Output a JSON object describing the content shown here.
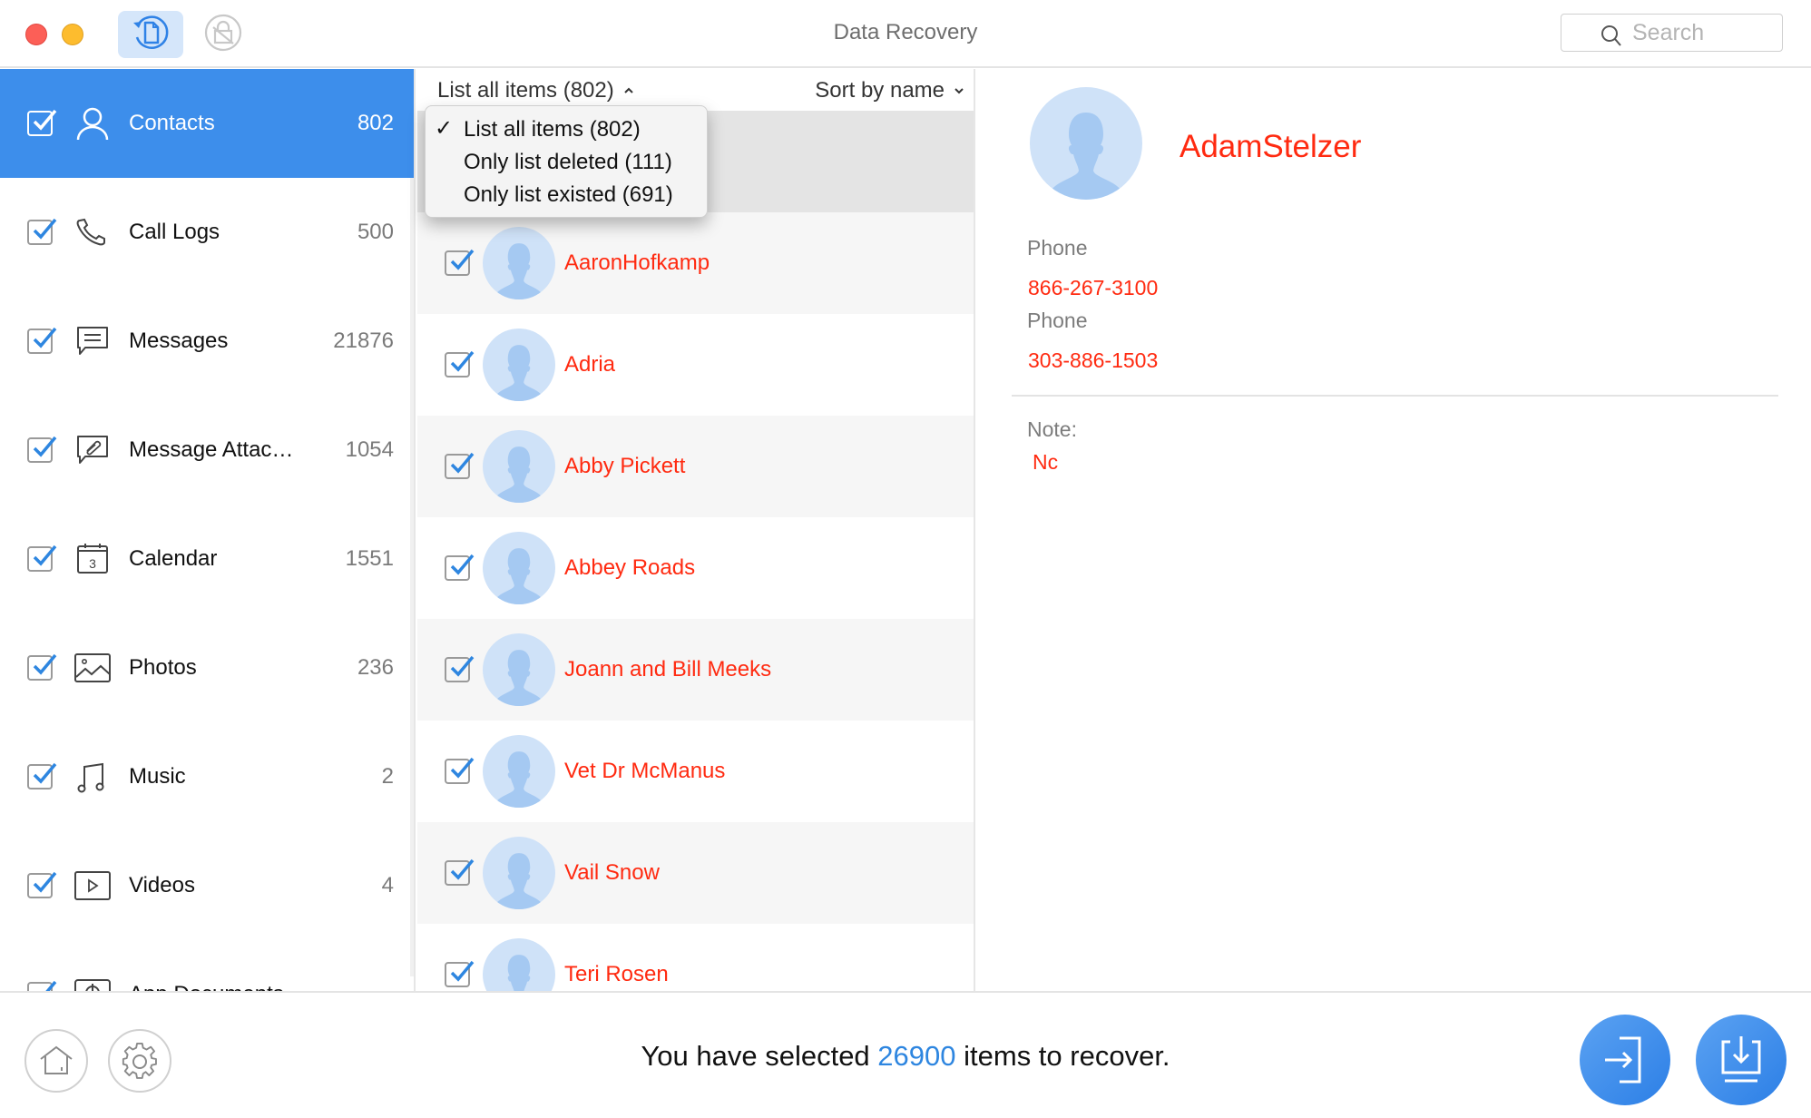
{
  "window": {
    "title": "Data Recovery",
    "search_placeholder": "Search",
    "toolbar": [
      {
        "name": "data-recovery-mode",
        "icon": "file-restore-icon",
        "active": true
      },
      {
        "name": "unlock-mode",
        "icon": "lock-icon",
        "active": false
      }
    ]
  },
  "sidebar": {
    "items": [
      {
        "label": "Contacts",
        "count": "802",
        "icon": "contact-icon",
        "checked": true,
        "selected": true
      },
      {
        "label": "Call Logs",
        "count": "500",
        "icon": "phone-icon",
        "checked": true
      },
      {
        "label": "Messages",
        "count": "21876",
        "icon": "message-icon",
        "checked": true
      },
      {
        "label": "Message Attac…",
        "count": "1054",
        "icon": "attachment-icon",
        "checked": true
      },
      {
        "label": "Calendar",
        "count": "1551",
        "icon": "calendar-icon",
        "checked": true,
        "icon_text": "3"
      },
      {
        "label": "Photos",
        "count": "236",
        "icon": "photo-icon",
        "checked": true
      },
      {
        "label": "Music",
        "count": "2",
        "icon": "music-icon",
        "checked": true
      },
      {
        "label": "Videos",
        "count": "4",
        "icon": "video-icon",
        "checked": true
      },
      {
        "label": "App Documents",
        "count": "",
        "icon": "app-document-icon",
        "checked": true
      }
    ]
  },
  "list": {
    "filter_label": "List all items (802)",
    "sort_label": "Sort by name",
    "filter_menu": {
      "options": [
        {
          "label": "List all items (802)",
          "checked": true
        },
        {
          "label": "Only list deleted (111)",
          "checked": false
        },
        {
          "label": "Only list existed (691)",
          "checked": false
        }
      ]
    },
    "contacts": [
      {
        "name": "AdamStelzer",
        "checked": true,
        "selected": true
      },
      {
        "name": "AaronHofkamp",
        "checked": true
      },
      {
        "name": "Adria",
        "checked": true
      },
      {
        "name": "Abby Pickett",
        "checked": true
      },
      {
        "name": "Abbey Roads",
        "checked": true
      },
      {
        "name": "Joann and Bill Meeks",
        "checked": true
      },
      {
        "name": "Vet Dr McManus",
        "checked": true
      },
      {
        "name": "Vail Snow",
        "checked": true
      },
      {
        "name": "Teri Rosen",
        "checked": true
      }
    ]
  },
  "detail": {
    "name": "AdamStelzer",
    "fields": [
      {
        "label": "Phone",
        "value": "866-267-3100"
      },
      {
        "label": "Phone",
        "value": "303-886-1503"
      }
    ],
    "note_label": "Note:",
    "note_value": "Nc"
  },
  "footer": {
    "status_prefix": "You have selected ",
    "selected_count": "26900",
    "status_suffix": " items to recover.",
    "buttons": {
      "home": "home-icon",
      "settings": "gear-icon",
      "export_to_device": "export-to-device-icon",
      "download_to_computer": "download-to-computer-icon"
    }
  },
  "colors": {
    "accent": "#3d8eeb",
    "deleted_text": "#ff2a10",
    "count_highlight": "#2e86e0",
    "avatar_bg": "#cfe2f8"
  }
}
